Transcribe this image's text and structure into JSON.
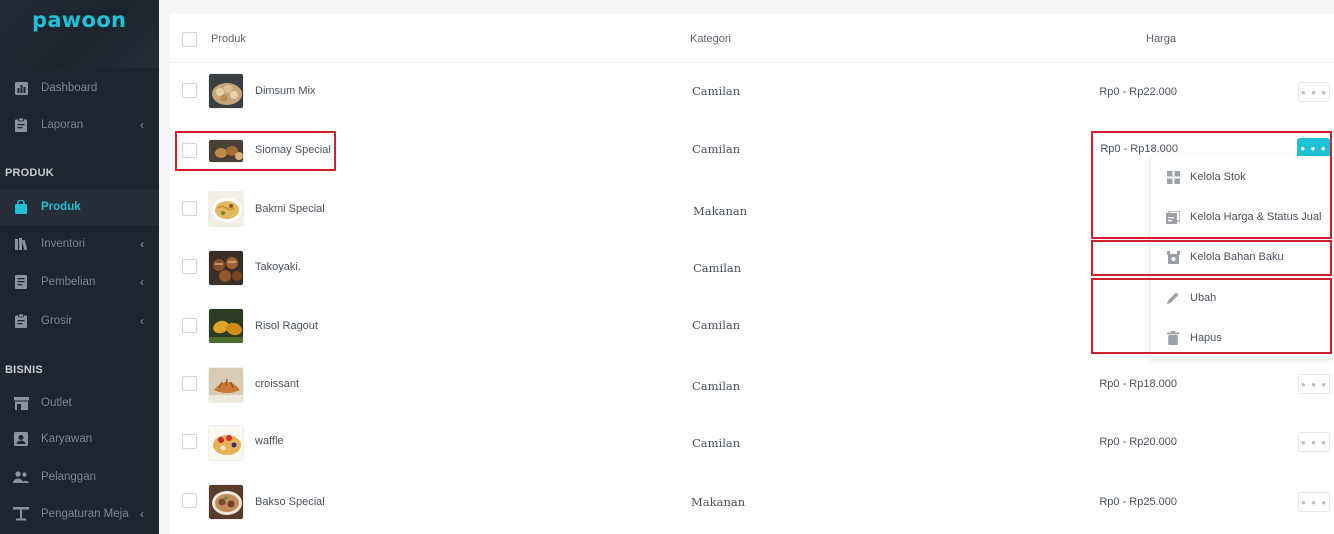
{
  "app": {
    "logo": "pawoon"
  },
  "sidebar": {
    "items_top": [
      {
        "label": "Dashboard",
        "icon": "bar-chart-icon",
        "chevron": false
      },
      {
        "label": "Laporan",
        "icon": "clipboard-icon",
        "chevron": true
      }
    ],
    "section_produk": "PRODUK",
    "items_produk": [
      {
        "label": "Produk",
        "icon": "bag-icon",
        "chevron": false,
        "active": true
      },
      {
        "label": "Inventori",
        "icon": "books-icon",
        "chevron": true
      },
      {
        "label": "Pembelian",
        "icon": "document-icon",
        "chevron": true
      },
      {
        "label": "Grosir",
        "icon": "clipboard-icon",
        "chevron": true
      }
    ],
    "section_bisnis": "BISNIS",
    "items_bisnis": [
      {
        "label": "Outlet",
        "icon": "store-icon",
        "chevron": false
      },
      {
        "label": "Karyawan",
        "icon": "id-card-icon",
        "chevron": false
      },
      {
        "label": "Pelanggan",
        "icon": "people-icon",
        "chevron": false
      },
      {
        "label": "Pengaturan Meja",
        "icon": "table-icon",
        "chevron": true
      }
    ]
  },
  "table": {
    "headers": {
      "product": "Produk",
      "category": "Kategori",
      "price": "Harga"
    },
    "rows": [
      {
        "name": "Dimsum Mix",
        "category": "Camilan",
        "price": "Rp0 - Rp22.000"
      },
      {
        "name": "Siomay Special",
        "category": "Camilan",
        "price": "Rp0 - Rp18.000"
      },
      {
        "name": "Bakmi Special",
        "category": "Makanan",
        "price": ""
      },
      {
        "name": "Takoyaki.",
        "category": "Camilan",
        "price": ""
      },
      {
        "name": "Risol Ragout",
        "category": "Camilan",
        "price": ""
      },
      {
        "name": "croissant",
        "category": "Camilan",
        "price": "Rp0 - Rp18.000"
      },
      {
        "name": "waffle",
        "category": "Camilan",
        "price": "Rp0 - Rp20.000"
      },
      {
        "name": "Bakso Special",
        "category": "Makanan",
        "price": "Rp0 - Rp25.000"
      }
    ],
    "more_button_glyph": "• • •"
  },
  "dropdown": {
    "items": [
      {
        "label": "Kelola Stok",
        "icon": "grid-icon"
      },
      {
        "label": "Kelola Harga & Status Jual",
        "icon": "price-tag-icon"
      },
      {
        "label": "Kelola Bahan Baku",
        "icon": "ingredient-icon"
      },
      {
        "label": "Ubah",
        "icon": "pencil-icon"
      },
      {
        "label": "Hapus",
        "icon": "trash-icon"
      }
    ]
  },
  "colors": {
    "accent": "#1fc1d6",
    "sidebar_bg": "#1e252e",
    "highlight": "#d0202e"
  }
}
